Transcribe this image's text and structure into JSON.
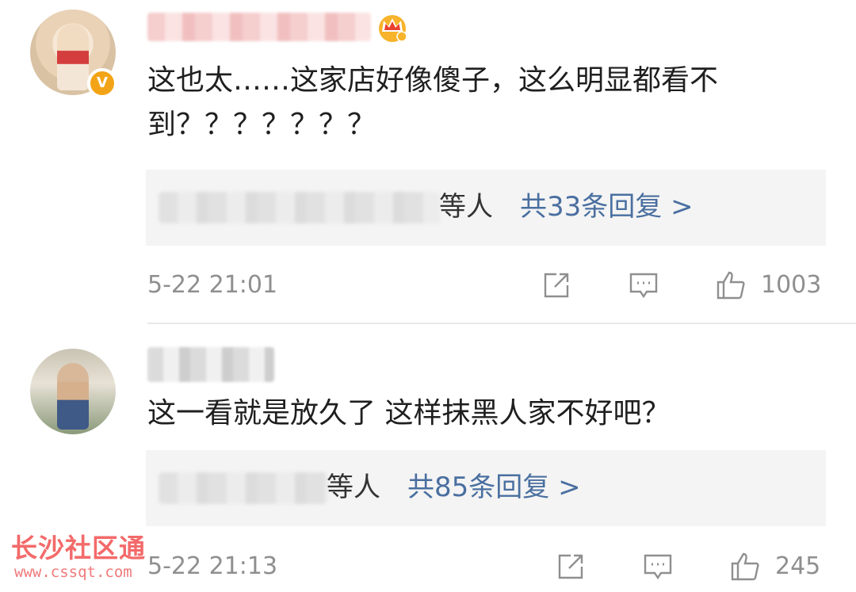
{
  "comments": [
    {
      "text": "这也太……这家店好像傻子，这么明显都看不到？？？？？？？",
      "reply_others": "等人",
      "reply_count": "共33条回复 >",
      "timestamp": "5-22 21:01",
      "likes": "1003",
      "verified_badge": "V",
      "badge_icon": "crown-icon"
    },
    {
      "text": "这一看就是放久了 这样抹黑人家不好吧？",
      "reply_others": "等人",
      "reply_count": "共85条回复 >",
      "timestamp": "5-22 21:13",
      "likes": "245"
    }
  ],
  "icons": {
    "share": "share-icon",
    "comment": "comment-icon",
    "like": "thumbs-up-icon"
  },
  "colors": {
    "link": "#4a6fa0",
    "meta": "#8f8f8f",
    "reply_bg": "#f4f4f4",
    "badge": "#f3a416",
    "watermark": "#f36a6a"
  },
  "watermark": {
    "title": "长沙社区通",
    "url": "www.cssqt.com"
  }
}
